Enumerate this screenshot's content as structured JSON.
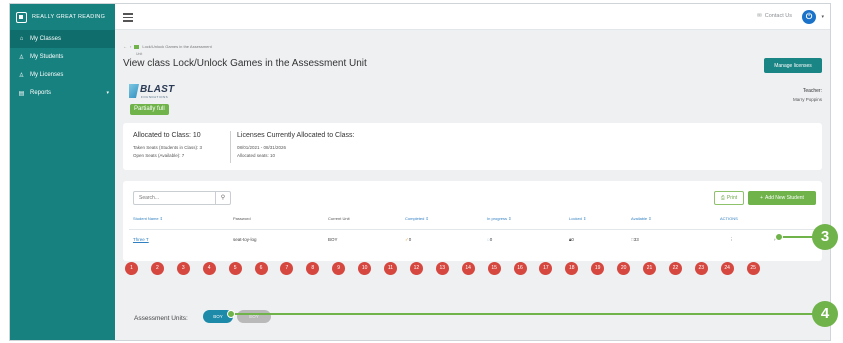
{
  "brand": {
    "name": "Really Great Reading"
  },
  "sidebar": {
    "items": [
      {
        "label": "My Classes",
        "icon": "home-icon",
        "active": true
      },
      {
        "label": "My Students",
        "icon": "person-icon"
      },
      {
        "label": "My Licenses",
        "icon": "person-icon"
      },
      {
        "label": "Reports",
        "icon": "report-icon",
        "caret": "▾"
      }
    ]
  },
  "topbar": {
    "contact_label": "Contact Us"
  },
  "breadcrumb": {
    "text": "Lock/Unlock Games in the Assessment",
    "sub": "Unit"
  },
  "page": {
    "title": "View class Lock/Unlock Games in the Assessment Unit",
    "manage_button": "Manage licenses",
    "logo_text": "BLAST",
    "logo_sub": "FOUNDATIONS",
    "status_badge": "Partially full",
    "teacher_label": "Teacher:",
    "teacher_name": "Marry Poppins"
  },
  "allocation": {
    "title": "Allocated to Class: 10",
    "taken": "Taken Seats (Students in Class): 3",
    "open": "Open Seats (Available): 7",
    "licenses_title": "Licenses Currently Allocated to Class:",
    "dates": "08/01/2021 - 08/31/2026",
    "seats": "Allocated seats: 10"
  },
  "table": {
    "search_placeholder": "Search...",
    "print_label": "Print",
    "add_label": "Add New Student",
    "headers": [
      "Student Name ⇕",
      "Password",
      "Current Unit",
      "Completed ⇕",
      "In progress ⇕",
      "Locked ⇕",
      "Available ⇕",
      "ACTIONS"
    ],
    "rows": [
      {
        "name": "Three T",
        "password": "seat-toy-log",
        "unit": "BOY",
        "completed": "0",
        "in_progress": "0",
        "locked": "0",
        "available": "33",
        "actions": "⋮",
        "expand": "›"
      }
    ]
  },
  "pager": {
    "pages": [
      "1",
      "2",
      "3",
      "4",
      "5",
      "6",
      "7",
      "8",
      "9",
      "10",
      "11",
      "12",
      "13",
      "14",
      "15",
      "16",
      "17",
      "18",
      "19",
      "20",
      "21",
      "22",
      "23",
      "24",
      "25"
    ]
  },
  "assessment": {
    "label": "Assessment Units:",
    "units": [
      "BOY",
      "EOY"
    ]
  },
  "callouts": [
    "3",
    "4"
  ],
  "colors": {
    "sidebar": "#17817f",
    "accent_green": "#6fb34a",
    "page_circle": "#d5473f",
    "unit_active": "#1c8aa8"
  }
}
